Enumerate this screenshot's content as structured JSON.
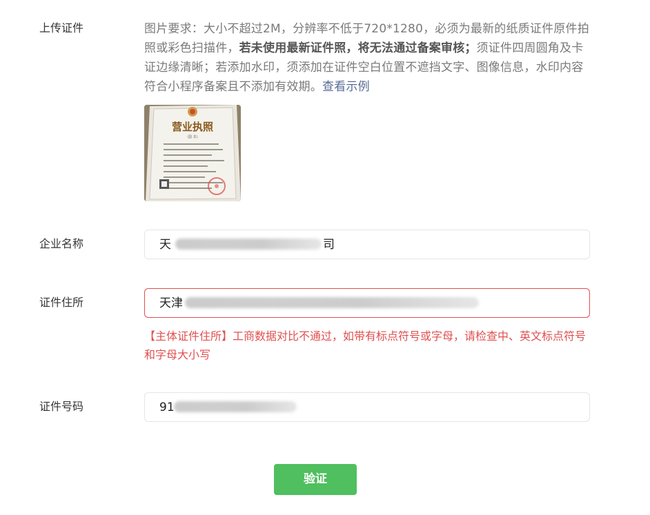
{
  "upload": {
    "label": "上传证件",
    "requirement_text": "图片要求：大小不超过2M，分辨率不低于720*1280，必须为最新的纸质证件原件拍照或彩色扫描件，",
    "requirement_bold": "若未使用最新证件照，将无法通过备案审核；",
    "requirement_rest": "须证件四周圆角及卡证边缘清晰；若添加水印，须添加在证件空白位置不遮挡文字、图像信息，水印内容符合小程序备案且不添加有效期。",
    "example_link": "查看示例",
    "thumbnail": {
      "title": "营业执照",
      "subtitle": "(副 本)"
    }
  },
  "company": {
    "label": "企业名称",
    "value_start": "天",
    "value_end": "司"
  },
  "address": {
    "label": "证件住所",
    "value_start": "天津",
    "error_message": "【主体证件住所】工商数据对比不通过，如带有标点符号或字母，请检查中、英文标点符号和字母大小写"
  },
  "cert_number": {
    "label": "证件号码",
    "value_start": "91"
  },
  "actions": {
    "verify_label": "验证"
  },
  "colors": {
    "error": "#e04f4f",
    "primary_button": "#4fbf5f",
    "link": "#576b95"
  }
}
